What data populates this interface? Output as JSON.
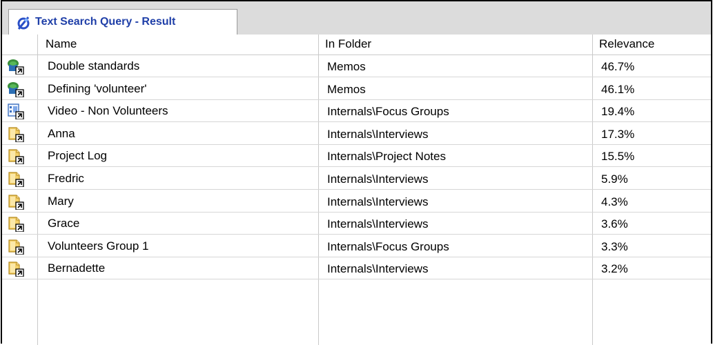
{
  "tab": {
    "title": "Text Search Query - Result",
    "icon": "query-result-icon"
  },
  "columns": {
    "name": "Name",
    "folder": "In Folder",
    "relevance": "Relevance"
  },
  "rows": [
    {
      "name": "Double standards",
      "folder": "Memos",
      "relevance": "46.7%",
      "icon": "memo-shortcut-icon"
    },
    {
      "name": "Defining 'volunteer'",
      "folder": "Memos",
      "relevance": "46.1%",
      "icon": "memo-shortcut-icon"
    },
    {
      "name": "Video - Non Volunteers",
      "folder": "Internals\\Focus Groups",
      "relevance": "19.4%",
      "icon": "video-shortcut-icon"
    },
    {
      "name": "Anna",
      "folder": "Internals\\Interviews",
      "relevance": "17.3%",
      "icon": "document-shortcut-icon"
    },
    {
      "name": "Project Log",
      "folder": "Internals\\Project Notes",
      "relevance": "15.5%",
      "icon": "document-shortcut-icon"
    },
    {
      "name": "Fredric",
      "folder": "Internals\\Interviews",
      "relevance": "5.9%",
      "icon": "document-shortcut-icon"
    },
    {
      "name": "Mary",
      "folder": "Internals\\Interviews",
      "relevance": "4.3%",
      "icon": "document-shortcut-icon"
    },
    {
      "name": "Grace",
      "folder": "Internals\\Interviews",
      "relevance": "3.6%",
      "icon": "document-shortcut-icon"
    },
    {
      "name": "Volunteers Group 1",
      "folder": "Internals\\Focus Groups",
      "relevance": "3.3%",
      "icon": "document-shortcut-icon"
    },
    {
      "name": "Bernadette",
      "folder": "Internals\\Interviews",
      "relevance": "3.2%",
      "icon": "document-shortcut-icon"
    }
  ]
}
